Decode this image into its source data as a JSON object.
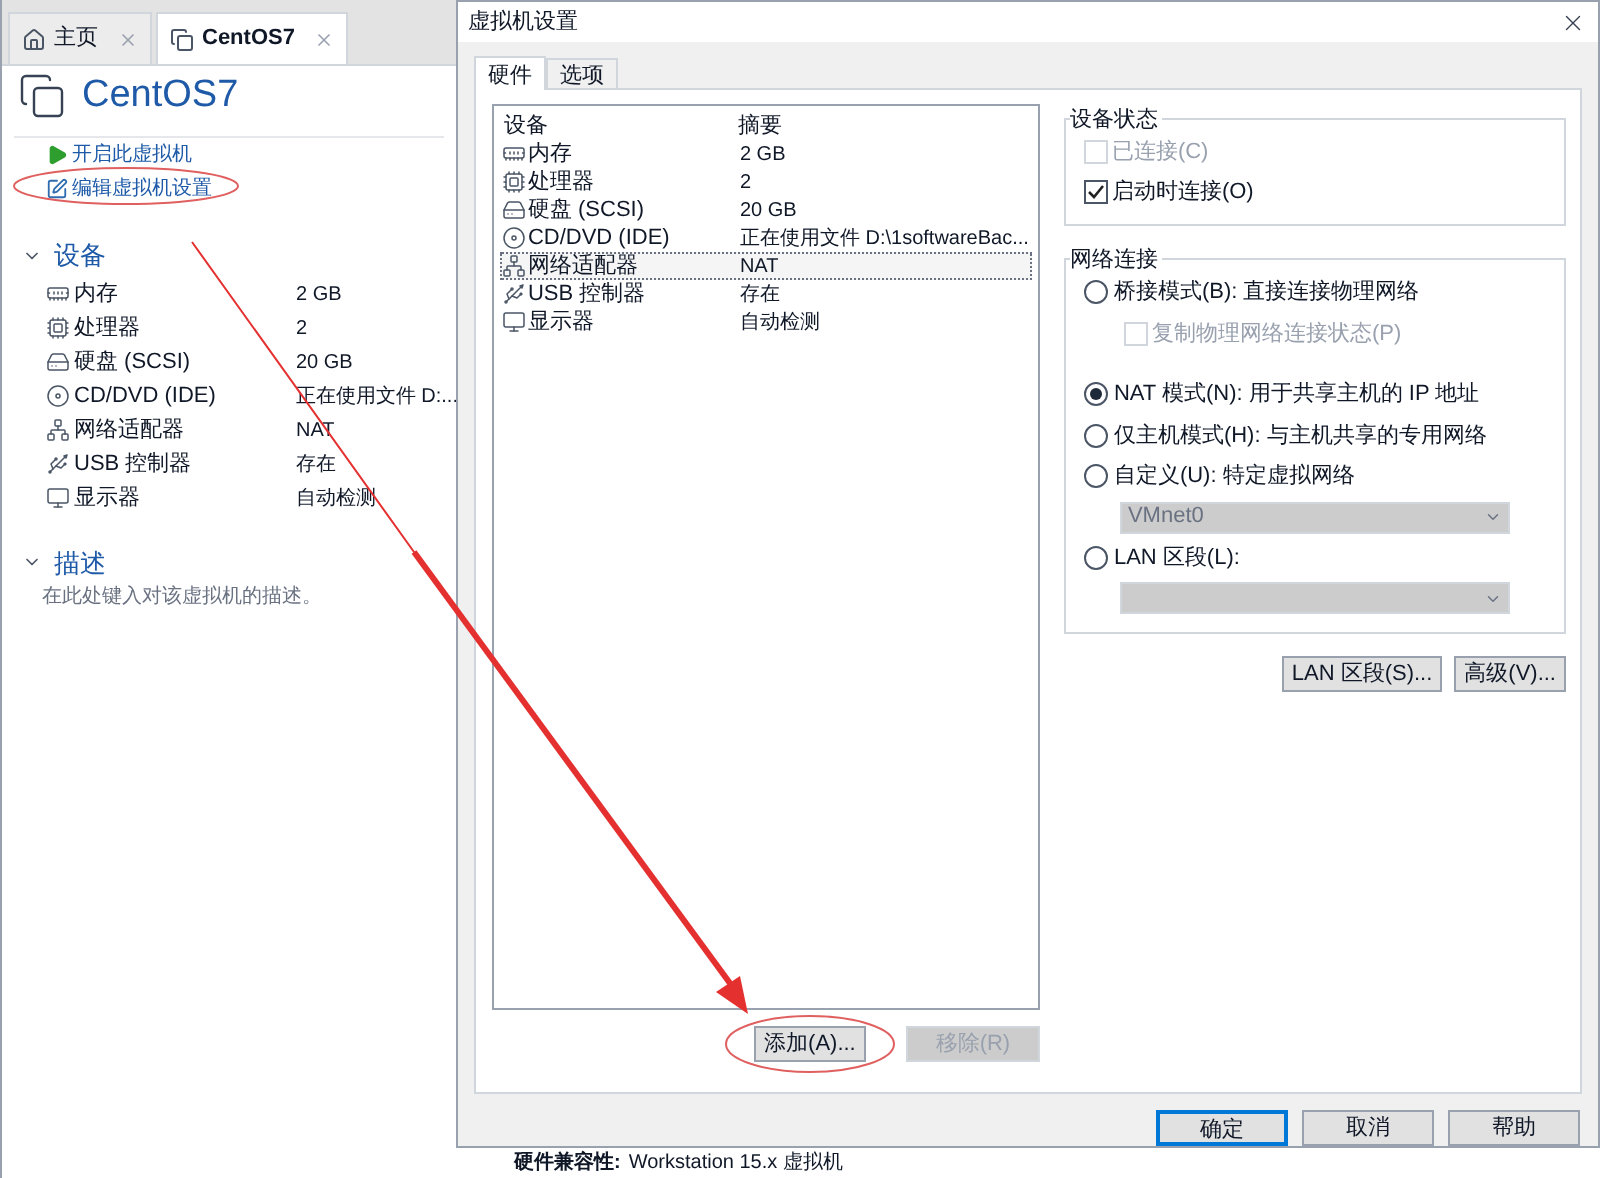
{
  "main_window": {
    "tabs": [
      {
        "label": "主页",
        "kind": "home",
        "selected": false
      },
      {
        "label": "CentOS7",
        "kind": "vm",
        "selected": true
      }
    ],
    "vm_title": "CentOS7",
    "actions": [
      {
        "label": "开启此虚拟机",
        "kind": "play"
      },
      {
        "label": "编辑虚拟机设置",
        "kind": "edit"
      }
    ],
    "devices_heading": "设备",
    "devices": [
      {
        "kind": "memory",
        "name": "内存",
        "value": "2 GB"
      },
      {
        "kind": "cpu",
        "name": "处理器",
        "value": "2"
      },
      {
        "kind": "disk",
        "name": "硬盘 (SCSI)",
        "value": "20 GB"
      },
      {
        "kind": "cd",
        "name": "CD/DVD (IDE)",
        "value": "正在使用文件 D:..."
      },
      {
        "kind": "network",
        "name": "网络适配器",
        "value": "NAT"
      },
      {
        "kind": "usb",
        "name": "USB 控制器",
        "value": "存在"
      },
      {
        "kind": "display",
        "name": "显示器",
        "value": "自动检测"
      }
    ],
    "description_heading": "描述",
    "description_placeholder": "在此处键入对该虚拟机的描述。",
    "compat_label": "硬件兼容性:",
    "compat_value": "Workstation 15.x 虚拟机"
  },
  "dialog": {
    "title": "虚拟机设置",
    "tabs": [
      {
        "label": "硬件",
        "selected": true
      },
      {
        "label": "选项",
        "selected": false
      }
    ],
    "columns": [
      "设备",
      "摘要"
    ],
    "devices": [
      {
        "kind": "memory",
        "name": "内存",
        "value": "2 GB",
        "selected": false
      },
      {
        "kind": "cpu",
        "name": "处理器",
        "value": "2",
        "selected": false
      },
      {
        "kind": "disk",
        "name": "硬盘 (SCSI)",
        "value": "20 GB",
        "selected": false
      },
      {
        "kind": "cd",
        "name": "CD/DVD (IDE)",
        "value": "正在使用文件 D:\\1softwareBac...",
        "selected": false
      },
      {
        "kind": "network",
        "name": "网络适配器",
        "value": "NAT",
        "selected": true
      },
      {
        "kind": "usb",
        "name": "USB 控制器",
        "value": "存在",
        "selected": false
      },
      {
        "kind": "display",
        "name": "显示器",
        "value": "自动检测",
        "selected": false
      }
    ],
    "add_button": "添加(A)...",
    "remove_button": {
      "label": "移除(R)",
      "disabled": true
    },
    "device_status": {
      "title": "设备状态",
      "options": [
        {
          "label": "已连接(C)",
          "checked": false,
          "disabled": true
        },
        {
          "label": "启动时连接(O)",
          "checked": true,
          "disabled": false
        }
      ]
    },
    "network": {
      "title": "网络连接",
      "options": [
        {
          "kind": "radio",
          "label": "桥接模式(B): 直接连接物理网络",
          "selected": false
        },
        {
          "kind": "checkbox",
          "label": "复制物理网络连接状态(P)",
          "checked": false,
          "disabled": true
        },
        {
          "kind": "radio",
          "label": "NAT 模式(N): 用于共享主机的 IP 地址",
          "selected": true
        },
        {
          "kind": "radio",
          "label": "仅主机模式(H): 与主机共享的专用网络",
          "selected": false
        },
        {
          "kind": "radio",
          "label": "自定义(U): 特定虚拟网络",
          "selected": false
        },
        {
          "kind": "select",
          "value": "VMnet0",
          "disabled": true
        },
        {
          "kind": "radio",
          "label": "LAN 区段(L):",
          "selected": false
        },
        {
          "kind": "select",
          "disabled": true
        }
      ],
      "buttons": [
        "LAN 区段(S)...",
        "高级(V)..."
      ]
    },
    "footer_buttons": [
      {
        "label": "确定",
        "default": true
      },
      {
        "label": "取消",
        "default": false
      },
      {
        "label": "帮助",
        "default": false
      }
    ]
  }
}
